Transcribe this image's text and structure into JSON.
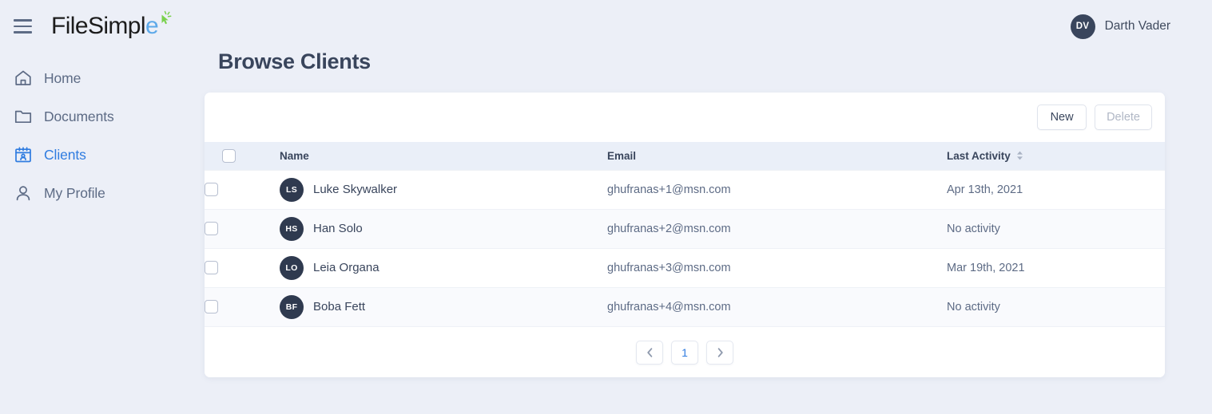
{
  "brand": {
    "name_prefix": "FileSimpl",
    "name_accent": "e",
    "sparkle_icon": "cursor-sparkle-icon"
  },
  "sidebar": {
    "menu_toggle": "hamburger-menu",
    "items": [
      {
        "label": "Home",
        "icon": "home-icon",
        "active": false
      },
      {
        "label": "Documents",
        "icon": "folder-icon",
        "active": false
      },
      {
        "label": "Clients",
        "icon": "calendar-user-icon",
        "active": true
      },
      {
        "label": "My Profile",
        "icon": "user-icon",
        "active": false
      }
    ]
  },
  "topbar": {
    "user": {
      "initials": "DV",
      "name": "Darth Vader"
    }
  },
  "page": {
    "title": "Browse Clients"
  },
  "toolbar": {
    "new_label": "New",
    "delete_label": "Delete"
  },
  "table": {
    "columns": {
      "name": "Name",
      "email": "Email",
      "last_activity": "Last Activity"
    },
    "sort_icon": "sort-updown-icon",
    "rows": [
      {
        "initials": "LS",
        "name": "Luke Skywalker",
        "email": "ghufranas+1@msn.com",
        "last_activity": "Apr 13th, 2021"
      },
      {
        "initials": "HS",
        "name": "Han Solo",
        "email": "ghufranas+2@msn.com",
        "last_activity": "No activity"
      },
      {
        "initials": "LO",
        "name": "Leia Organa",
        "email": "ghufranas+3@msn.com",
        "last_activity": "Mar 19th, 2021"
      },
      {
        "initials": "BF",
        "name": "Boba Fett",
        "email": "ghufranas+4@msn.com",
        "last_activity": "No activity"
      }
    ]
  },
  "pagination": {
    "prev_icon": "chevron-left-icon",
    "next_icon": "chevron-right-icon",
    "current_page": "1"
  },
  "colors": {
    "background": "#eceff7",
    "accent_blue": "#2f7ce0",
    "logo_blue": "#5da9e9",
    "logo_green": "#7ad14e",
    "text_dark": "#39455c",
    "text_muted": "#5d6b85",
    "avatar_dark": "#2f3a4f",
    "header_row": "#eaeff8",
    "row_alt": "#f9fafd"
  }
}
